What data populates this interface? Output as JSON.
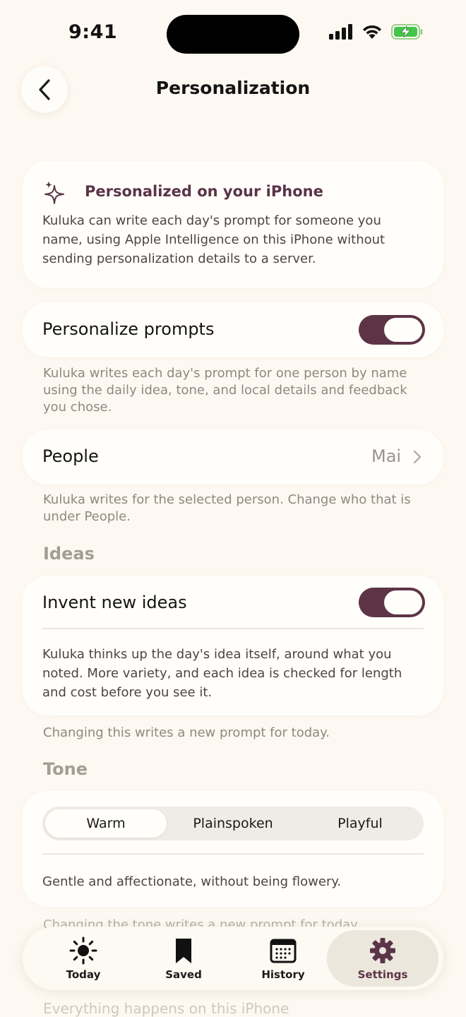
{
  "status": {
    "time": "9:41"
  },
  "nav": {
    "title": "Personalization"
  },
  "info_card": {
    "title": "Personalized on your iPhone",
    "body": "Kuluka can write each day's prompt for someone you name, using Apple Intelligence on this iPhone without sending personalization details to a server."
  },
  "personalize": {
    "label": "Personalize prompts",
    "enabled": true,
    "footer": "Kuluka writes each day's prompt for one person by name using the daily idea, tone, and local details and feedback you chose."
  },
  "people": {
    "label": "People",
    "value": "Mai",
    "footer": "Kuluka writes for the selected person. Change who that is under People."
  },
  "ideas": {
    "section": "Ideas",
    "label": "Invent new ideas",
    "enabled": true,
    "description": "Kuluka thinks up the day's idea itself, around what you noted. More variety, and each idea is checked for length and cost before you see it.",
    "footer": "Changing this writes a new prompt for today."
  },
  "tone": {
    "section": "Tone",
    "options": [
      "Warm",
      "Plainspoken",
      "Playful"
    ],
    "selected": "Warm",
    "description": "Gentle and affectionate, without being flowery.",
    "footer": "Changing the tone writes a new prompt for today."
  },
  "below": {
    "text": "Everything happens on this iPhone"
  },
  "tabbar": {
    "items": [
      "Today",
      "Saved",
      "History",
      "Settings"
    ],
    "active": "Settings"
  },
  "colors": {
    "accent": "#5d3446",
    "background": "#fdf8f1"
  }
}
